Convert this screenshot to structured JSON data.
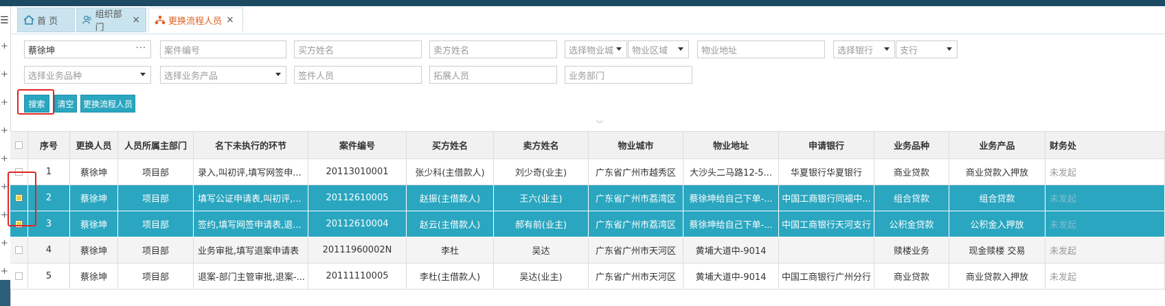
{
  "tabs": [
    {
      "label": "首 页",
      "icon": "home-icon",
      "closable": false
    },
    {
      "label": "组织部门",
      "icon": "users-icon",
      "closable": true
    },
    {
      "label": "更换流程人员",
      "icon": "org-tree-icon",
      "closable": true
    }
  ],
  "close_glyph": "×",
  "filters": {
    "row1": [
      {
        "value": "蔡徐坤",
        "placeholder": "",
        "more": "···"
      },
      {
        "placeholder": "案件编号"
      },
      {
        "placeholder": "买方姓名"
      },
      {
        "placeholder": "卖方姓名"
      },
      {
        "placeholder": "选择物业城"
      },
      {
        "placeholder": "物业区域"
      },
      {
        "placeholder": "物业地址"
      },
      {
        "placeholder": "选择银行"
      },
      {
        "placeholder": "支行"
      }
    ],
    "row2": [
      {
        "placeholder": "选择业务品种"
      },
      {
        "placeholder": "选择业务产品"
      },
      {
        "placeholder": "签件人员"
      },
      {
        "placeholder": "拓展人员"
      },
      {
        "placeholder": "业务部门"
      }
    ]
  },
  "buttons": {
    "search": "搜索",
    "clear": "清空",
    "change": "更换流程人员"
  },
  "collapse_glyph": "︾",
  "columns": [
    "序号",
    "更换人员",
    "人员所属主部门",
    "名下未执行的环节",
    "案件编号",
    "买方姓名",
    "卖方姓名",
    "物业城市",
    "物业地址",
    "申请银行",
    "业务品种",
    "业务产品",
    "财务处"
  ],
  "rows": [
    {
      "checked": false,
      "selected": false,
      "cells": [
        "1",
        "蔡徐坤",
        "项目部",
        "录入,叫初评,填写网签申...",
        "20113010001",
        "张少科(主借款人)",
        "刘少奇(业主)",
        "广东省广州市越秀区",
        "大沙头二马路12-5...",
        "华夏银行华夏银行",
        "商业贷款",
        "商业贷款入押放",
        "未发起"
      ]
    },
    {
      "checked": true,
      "selected": true,
      "cells": [
        "2",
        "蔡徐坤",
        "项目部",
        "填写公证申请表,叫初评,...",
        "20112610005",
        "赵振(主借款人)",
        "王六(业主)",
        "广东省广州市荔湾区",
        "蔡徐坤给自己下单-...",
        "中国工商银行同福中...",
        "组合贷款",
        "组合贷款",
        "未发起"
      ]
    },
    {
      "checked": true,
      "selected": true,
      "cells": [
        "3",
        "蔡徐坤",
        "项目部",
        "签约,填写网签申请表,退...",
        "20112610004",
        "赵云(主借款人)",
        "郝有前(业主)",
        "广东省广州市荔湾区",
        "蔡徐坤给自己下单-...",
        "中国工商银行天河支行",
        "公积金贷款",
        "公积金入押放",
        "未发起"
      ]
    },
    {
      "checked": false,
      "selected": false,
      "cells": [
        "4",
        "蔡徐坤",
        "项目部",
        "业务审批,填写退案申请表",
        "20111960002N",
        "李杜",
        "吴达",
        "广东省广州市天河区",
        "黄埔大道中-9014",
        "",
        "赎楼业务",
        "现金赎楼 交易",
        "未发起"
      ]
    },
    {
      "checked": false,
      "selected": false,
      "cells": [
        "5",
        "蔡徐坤",
        "项目部",
        "退案-部门主管审批,退案-...",
        "20111110005",
        "李杜(主借款人)",
        "吴达(业主)",
        "广东省广州市天河区",
        "黄埔大道中-9014",
        "中国工商银行广州分行",
        "商业贷款",
        "商业贷款入押放",
        "未发起"
      ]
    }
  ],
  "colors": {
    "accent": "#2aa6c0",
    "highlight": "#e02424",
    "topbar": "#1d4a63",
    "active_tab": "#e0601e"
  }
}
